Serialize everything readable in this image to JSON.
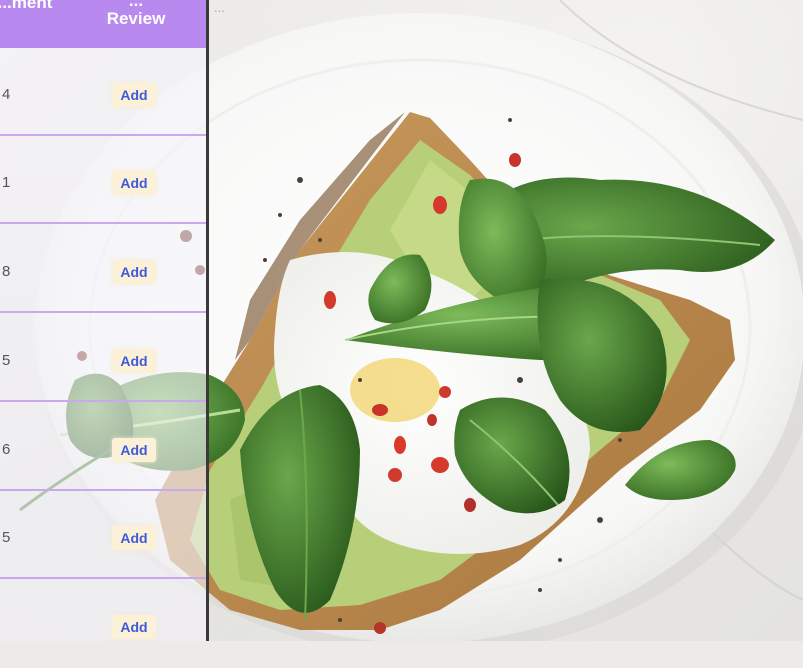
{
  "table": {
    "header_left": "...ment",
    "header_right_line1": "...",
    "header_right_line2": "Review",
    "rows": [
      {
        "count": "4",
        "button_label": "Add"
      },
      {
        "count": "1",
        "button_label": "Add"
      },
      {
        "count": "8",
        "button_label": "Add"
      },
      {
        "count": "5",
        "button_label": "Add"
      },
      {
        "count": "6",
        "button_label": "Add"
      },
      {
        "count": "5",
        "button_label": "Add"
      },
      {
        "count": "",
        "button_label": "Add"
      }
    ],
    "colors": {
      "header_bg": "#b88af0",
      "row_divider": "#c9a8ee",
      "add_button_text": "#3f5ad8",
      "add_button_bg": "#fbf0d8"
    }
  },
  "photo": {
    "subject": "avocado-toast-with-poached-egg-and-spinach",
    "plate_color": "#ffffff",
    "stray_text": "..."
  }
}
